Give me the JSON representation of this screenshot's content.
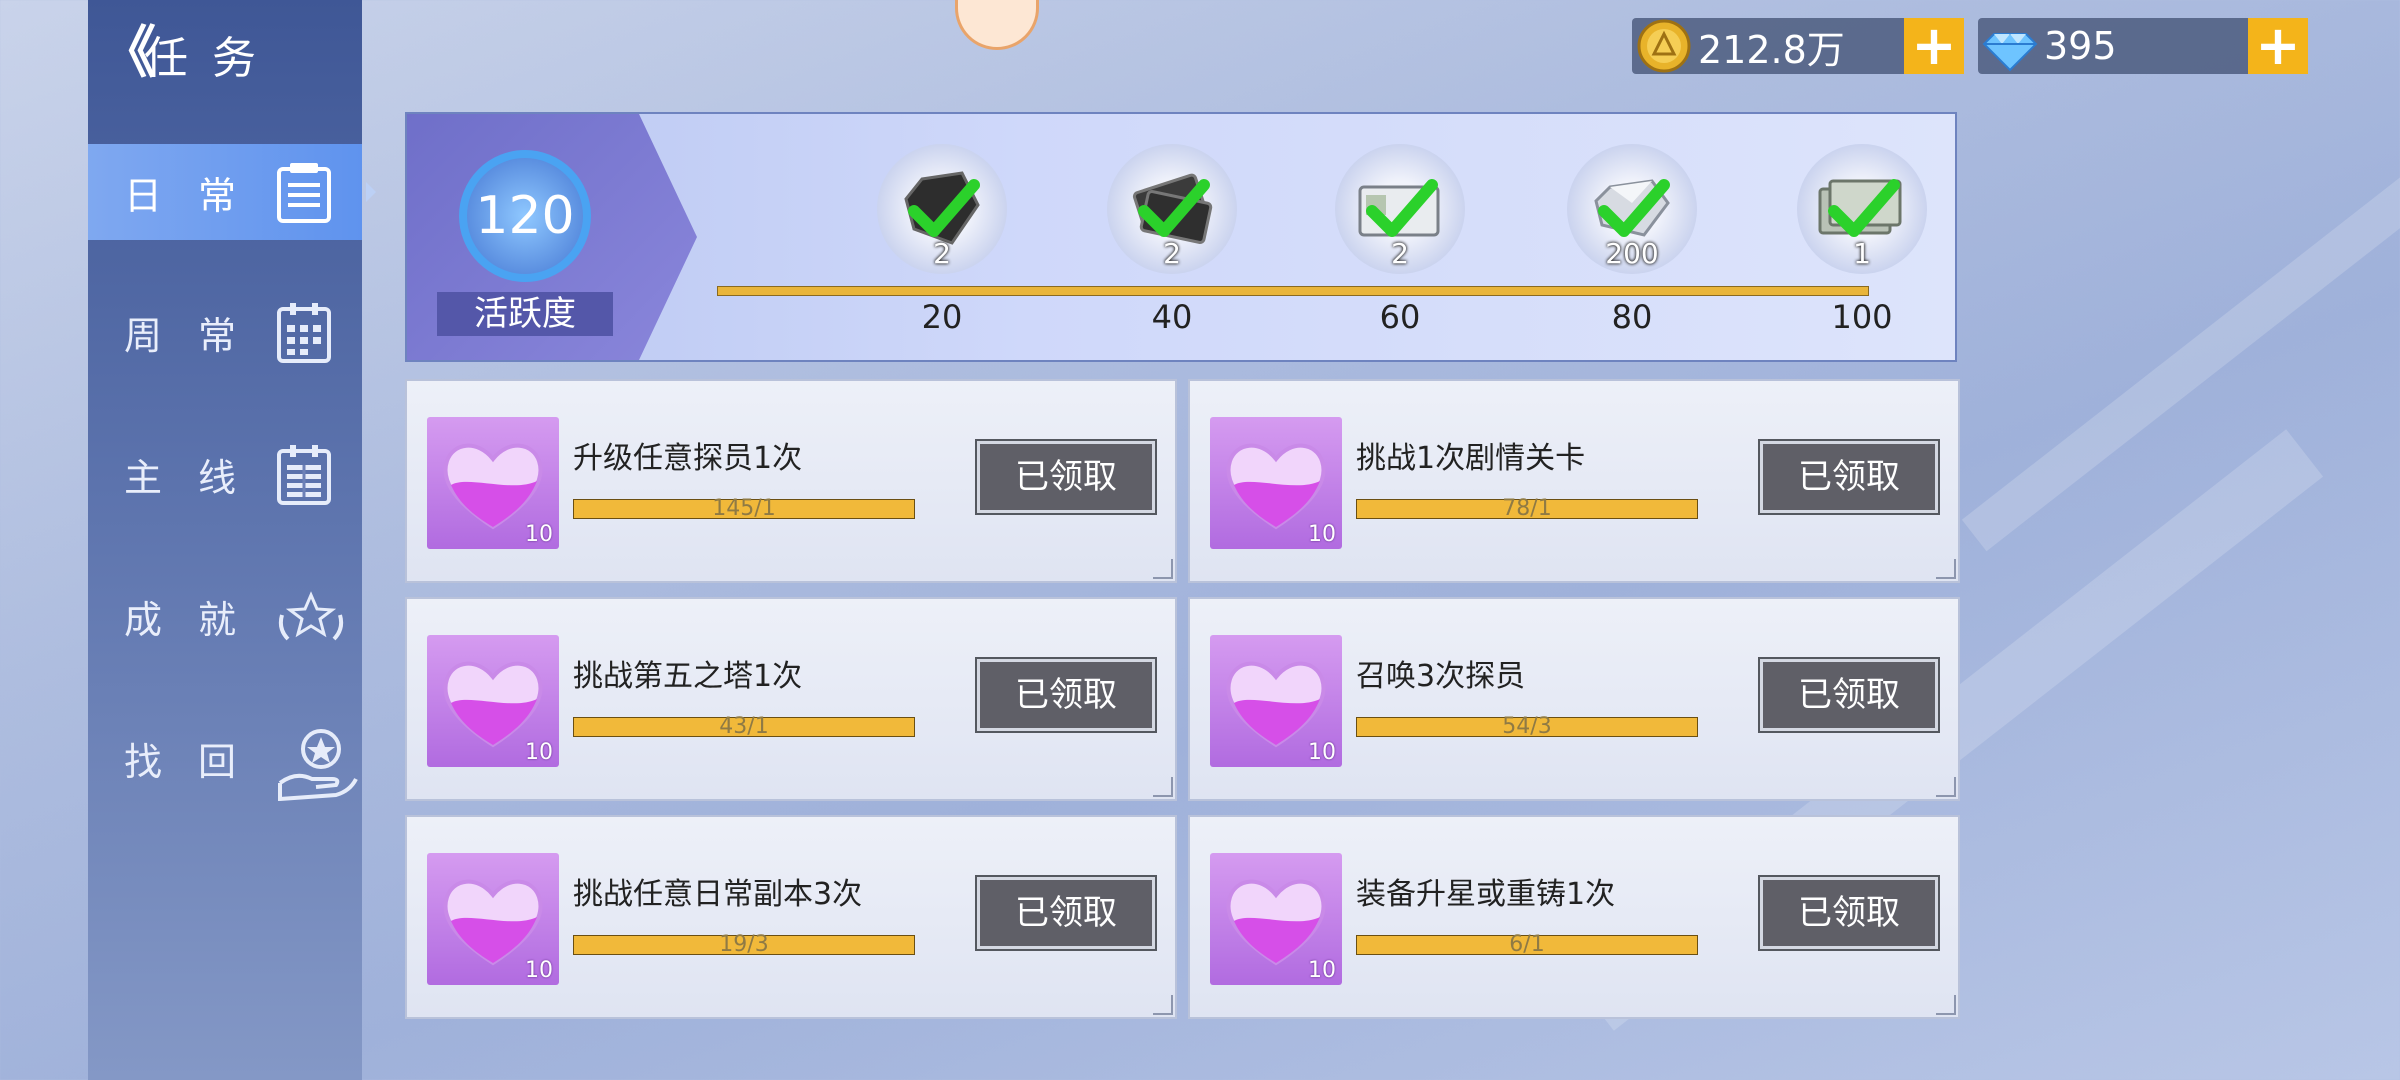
{
  "header": {
    "back_glyph": "《",
    "title": "任务"
  },
  "sidebar": {
    "items": [
      {
        "label": "日常",
        "icon": "daily-clipboard-icon",
        "active": true
      },
      {
        "label": "周常",
        "icon": "weekly-calendar-icon",
        "active": false
      },
      {
        "label": "主线",
        "icon": "mainline-calendar-icon",
        "active": false
      },
      {
        "label": "成就",
        "icon": "achievement-laurel-icon",
        "active": false
      },
      {
        "label": "找回",
        "icon": "retrieve-hand-icon",
        "active": false
      }
    ]
  },
  "currency": {
    "gold": {
      "value": "212.8万",
      "icon": "gold-coin-icon",
      "plus": "+"
    },
    "diamond": {
      "value": "395",
      "icon": "diamond-icon",
      "plus": "+"
    }
  },
  "activity": {
    "points": "120",
    "label": "活跃度",
    "milestones": [
      {
        "threshold": "20",
        "count": "2",
        "claimed": true,
        "icon": "black-crystal-icon"
      },
      {
        "threshold": "40",
        "count": "2",
        "claimed": true,
        "icon": "ticket-bundle-icon"
      },
      {
        "threshold": "60",
        "count": "2",
        "claimed": true,
        "icon": "card-pass-icon"
      },
      {
        "threshold": "80",
        "count": "200",
        "claimed": true,
        "icon": "silver-crystal-icon"
      },
      {
        "threshold": "100",
        "count": "1",
        "claimed": true,
        "icon": "envelope-bundle-icon"
      }
    ]
  },
  "tasks": [
    {
      "name": "升级任意探员1次",
      "progress": "145/1",
      "reward": "10",
      "button": "已领取"
    },
    {
      "name": "挑战1次剧情关卡",
      "progress": "78/1",
      "reward": "10",
      "button": "已领取"
    },
    {
      "name": "挑战第五之塔1次",
      "progress": "43/1",
      "reward": "10",
      "button": "已领取"
    },
    {
      "name": "召唤3次探员",
      "progress": "54/3",
      "reward": "10",
      "button": "已领取"
    },
    {
      "name": "挑战任意日常副本3次",
      "progress": "19/3",
      "reward": "10",
      "button": "已领取"
    },
    {
      "name": "装备升星或重铸1次",
      "progress": "6/1",
      "reward": "10",
      "button": "已领取"
    }
  ],
  "colors": {
    "accent": "#f4b41a",
    "sidebar_active": "#5f93ee",
    "progress": "#f1b93a",
    "check": "#2bd12b",
    "heart": "#e07af5"
  }
}
